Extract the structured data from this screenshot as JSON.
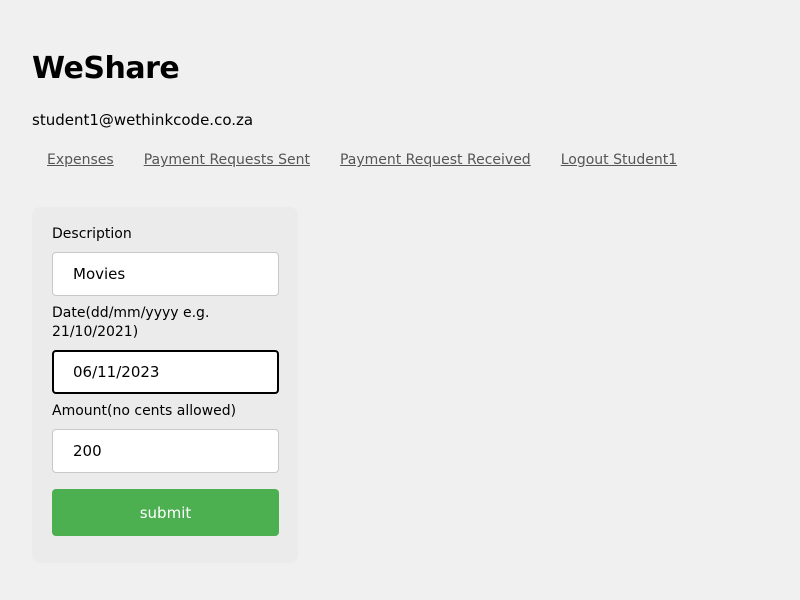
{
  "app": {
    "title": "WeShare",
    "user_email": "student1@wethinkcode.co.za"
  },
  "nav": {
    "items": [
      {
        "label": "Expenses"
      },
      {
        "label": "Payment Requests Sent"
      },
      {
        "label": "Payment Request Received"
      },
      {
        "label": "Logout Student1"
      }
    ]
  },
  "form": {
    "description": {
      "label": "Description",
      "value": "Movies"
    },
    "date": {
      "label": "Date(dd/mm/yyyy e.g. 21/10/2021)",
      "value": "06/11/2023"
    },
    "amount": {
      "label": "Amount(no cents allowed)",
      "value": "200"
    },
    "submit_label": "submit"
  },
  "colors": {
    "background": "#f0f0f0",
    "card": "#ebebeb",
    "submit": "#4caf50",
    "link": "#555555"
  }
}
